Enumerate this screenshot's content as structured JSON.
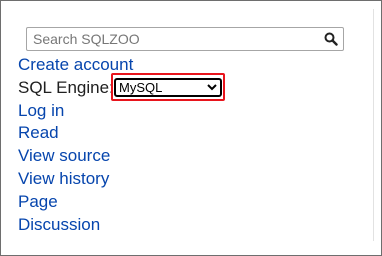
{
  "search": {
    "placeholder": "Search SQLZOO",
    "icon": "search-icon"
  },
  "menu": {
    "create_account": "Create account",
    "engine_label": "SQL Engine:",
    "engine_selected": "MySQL",
    "log_in": "Log in",
    "read": "Read",
    "view_source": "View source",
    "view_history": "View history",
    "page": "Page",
    "discussion": "Discussion"
  },
  "colors": {
    "link": "#0645ad",
    "highlight": "#e8141c"
  }
}
